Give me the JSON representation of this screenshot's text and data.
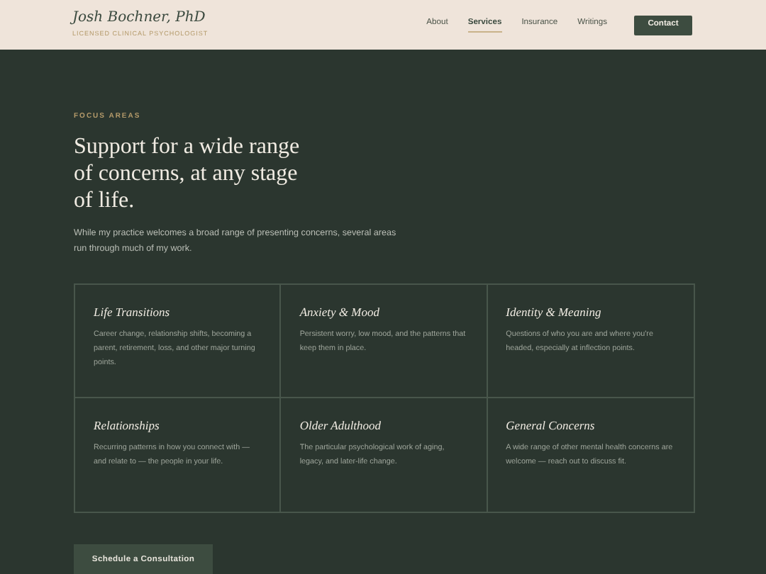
{
  "header": {
    "name": "Josh Bochner, PhD",
    "subtitle": "LICENSED CLINICAL PSYCHOLOGIST",
    "nav": [
      {
        "label": "About",
        "selected": false
      },
      {
        "label": "Services",
        "selected": true
      },
      {
        "label": "Insurance",
        "selected": false
      },
      {
        "label": "Writings",
        "selected": false
      }
    ],
    "contact_button": "Contact"
  },
  "section": {
    "eyebrow": "FOCUS AREAS",
    "heading": "Support for a wide range of concerns, at any stage of life.",
    "intro": "While my practice welcomes a broad range of presenting concerns, several areas run through much of my work.",
    "areas": [
      {
        "title": "Life Transitions",
        "text": "Career change, relationship shifts, becoming a parent, retirement, loss, and other major turning points."
      },
      {
        "title": "Anxiety & Mood",
        "text": "Persistent worry, low mood, and the patterns that keep them in place."
      },
      {
        "title": "Identity & Meaning",
        "text": "Questions of who you are and where you're headed, especially at inflection points."
      },
      {
        "title": "Relationships",
        "text": "Recurring patterns in how you connect with — and relate to — the people in your life."
      },
      {
        "title": "Older Adulthood",
        "text": "The particular psychological work of aging, legacy, and later-life change."
      },
      {
        "title": "General Concerns",
        "text": "A wide range of other mental health concerns are welcome — reach out to discuss fit."
      }
    ],
    "cta": "Schedule a Consultation"
  }
}
